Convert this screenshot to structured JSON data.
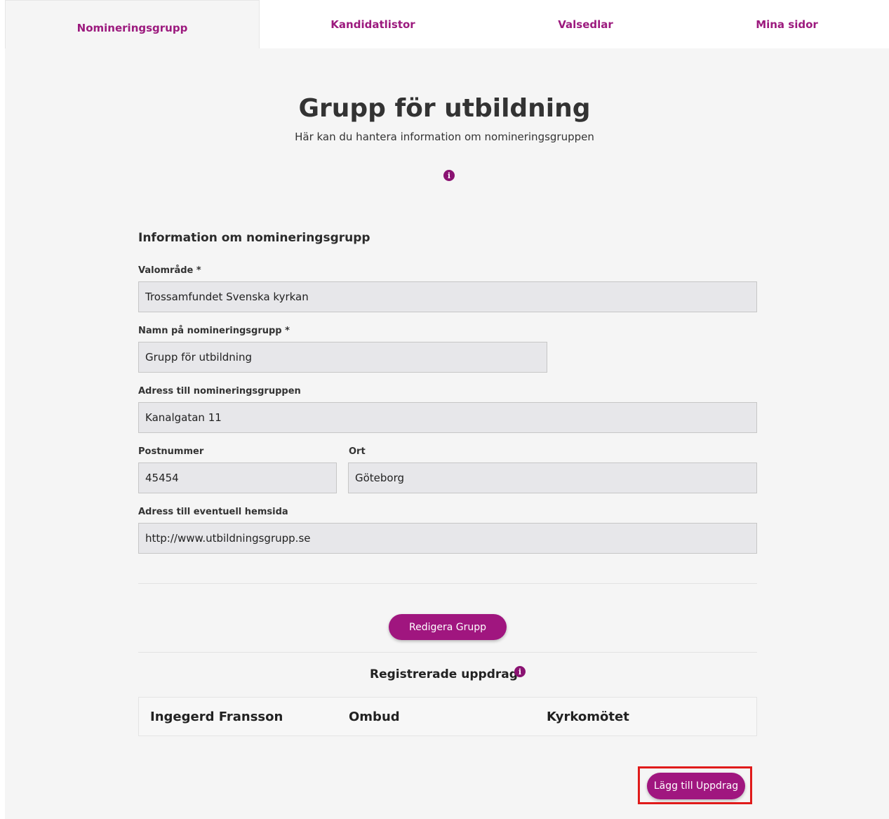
{
  "tabs": [
    {
      "label": "Nomineringsgrupp",
      "active": true
    },
    {
      "label": "Kandidatlistor",
      "active": false
    },
    {
      "label": "Valsedlar",
      "active": false
    },
    {
      "label": "Mina sidor",
      "active": false
    }
  ],
  "page": {
    "title": "Grupp för utbildning",
    "subtitle": "Här kan du hantera information om nomineringsgruppen"
  },
  "form": {
    "heading": "Information om nomineringsgrupp",
    "valomrade": {
      "label": "Valområde *",
      "value": "Trossamfundet Svenska kyrkan"
    },
    "namn": {
      "label": "Namn på nomineringsgrupp *",
      "value": "Grupp för utbildning"
    },
    "adress": {
      "label": "Adress till nomineringsgruppen",
      "value": "Kanalgatan 11"
    },
    "postnummer": {
      "label": "Postnummer",
      "value": "45454"
    },
    "ort": {
      "label": "Ort",
      "value": "Göteborg"
    },
    "hemsida": {
      "label": "Adress till eventuell hemsida",
      "value": "http://www.utbildningsgrupp.se"
    }
  },
  "edit_button": "Redigera Grupp",
  "assignments": {
    "heading": "Registrerade uppdrag",
    "rows": [
      {
        "name": "Ingegerd Fransson",
        "role": "Ombud",
        "body": "Kyrkomötet"
      }
    ]
  },
  "add_button": "Lägg till Uppdrag",
  "colors": {
    "accent": "#a0167f",
    "highlight": "#e01b1b",
    "background": "#f5f5f5"
  },
  "icons": {
    "info": "info-icon"
  }
}
